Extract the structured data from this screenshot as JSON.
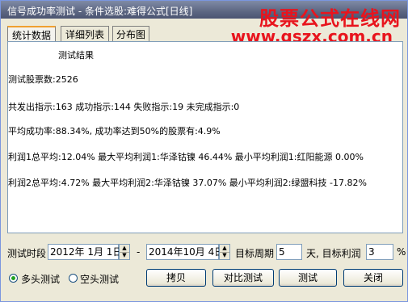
{
  "window": {
    "title": "信号成功率测试 - 条件选股:难得公式[日线]"
  },
  "watermark": {
    "cn": "股票公式在线网",
    "url": "www.gszx.com.cn"
  },
  "tabs": [
    {
      "label": "统计数据",
      "active": true
    },
    {
      "label": "详细列表",
      "active": false
    },
    {
      "label": "分布图",
      "active": false
    }
  ],
  "results": {
    "heading": "测试结果",
    "lines": [
      "测试股票数:2526",
      "共发出指示:163 成功指示:144 失败指示:19 未完成指示:0",
      "平均成功率:88.34%, 成功率达到50%的股票有:4.9%",
      "利润1总平均:12.04% 最大平均利润1:华泽钴镍 46.44% 最小平均利润1:红阳能源 0.00%",
      "利润2总平均:4.72% 最大平均利润2:华泽钴镍 37.07% 最小平均利润2:绿盟科技 -17.82%"
    ]
  },
  "controls": {
    "period_label": "测试时段",
    "start_date": "2012年 1月 1日",
    "dash": "-",
    "end_date": "2014年10月 4日",
    "target_period_label": "目标周期",
    "target_period_value": "5",
    "days_target_profit_label": "天, 目标利润",
    "target_profit_value": "3",
    "percent": "%"
  },
  "options": {
    "long_label": "多头测试",
    "long_selected": true,
    "short_label": "空头测试",
    "short_selected": false
  },
  "buttons": {
    "copy": "拷贝",
    "compare": "对比测试",
    "test": "测试",
    "close": "关闭"
  }
}
